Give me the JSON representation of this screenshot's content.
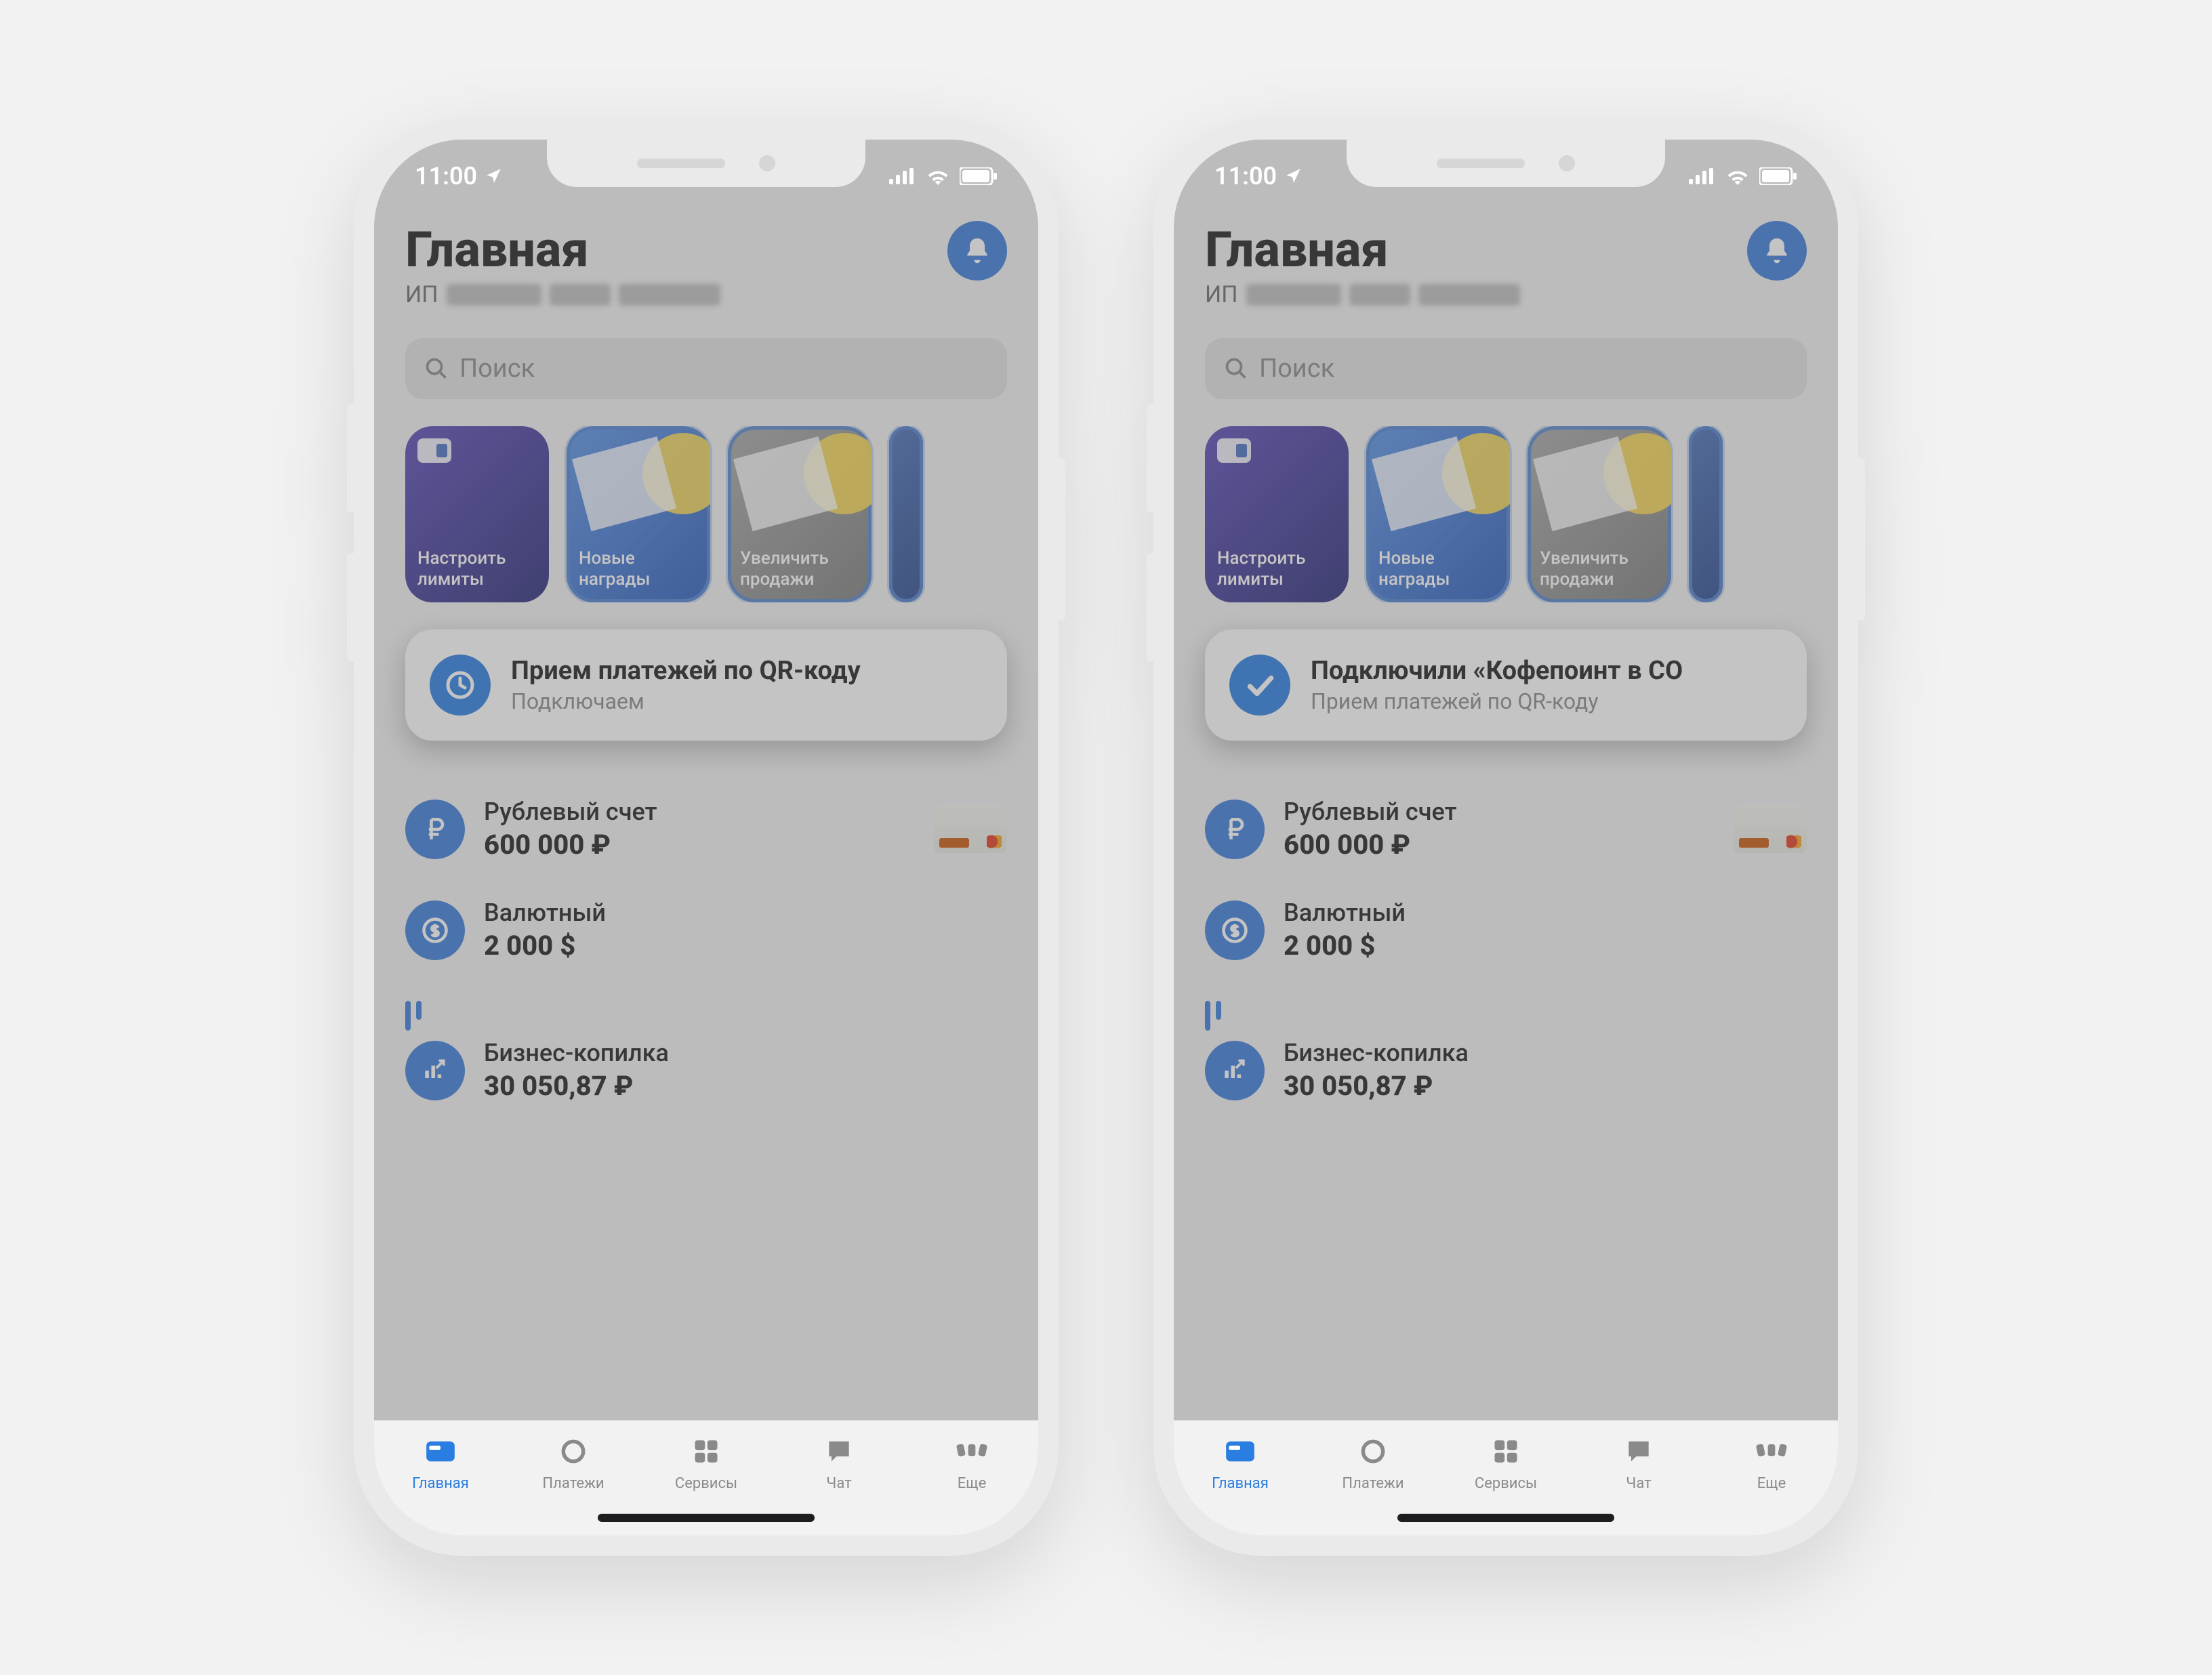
{
  "status": {
    "time": "11:00"
  },
  "header": {
    "title": "Главная",
    "subtitle_prefix": "ИП"
  },
  "search": {
    "placeholder": "Поиск"
  },
  "stories": [
    {
      "label": "Настроить лимиты"
    },
    {
      "label": "Новые награды"
    },
    {
      "label": "Увеличить продажи"
    }
  ],
  "cards": {
    "left": {
      "title": "Прием платежей по QR-коду",
      "subtitle": "Подключаем",
      "icon": "clock"
    },
    "right": {
      "title": "Подключили «Кофепоинт в СО",
      "subtitle": "Прием платежей по QR-коду",
      "icon": "check"
    }
  },
  "accounts": [
    {
      "name": "Рублевый счет",
      "balance": "600 000 ₽",
      "icon": "ruble",
      "has_card": true
    },
    {
      "name": "Валютный",
      "balance": "2 000 $",
      "icon": "dollar",
      "has_card": false
    }
  ],
  "savings": {
    "name": "Бизнес-копилка",
    "balance": "30 050,87 ₽"
  },
  "tabs": [
    {
      "label": "Главная",
      "active": true
    },
    {
      "label": "Платежи",
      "active": false
    },
    {
      "label": "Сервисы",
      "active": false
    },
    {
      "label": "Чат",
      "active": false
    },
    {
      "label": "Еще",
      "active": false
    }
  ]
}
